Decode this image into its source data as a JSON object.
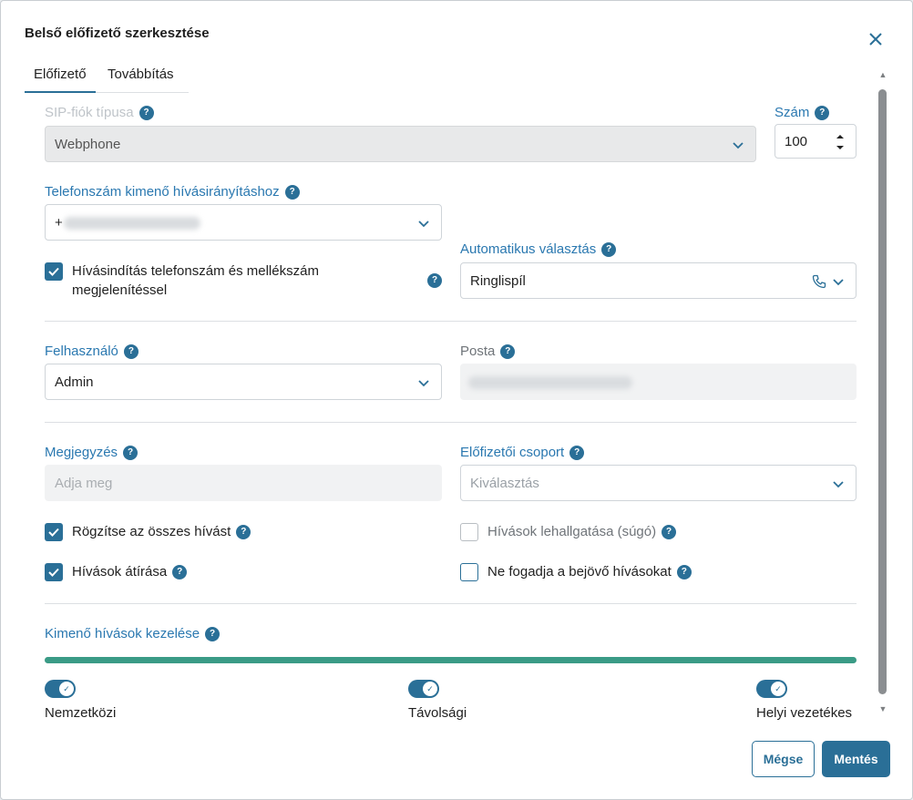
{
  "dialog": {
    "title": "Belső előfizető szerkesztése"
  },
  "tabs": [
    {
      "label": "Előfizető",
      "active": true
    },
    {
      "label": "Továbbítás",
      "active": false
    }
  ],
  "sip_type": {
    "label": "SIP-fiók típusa",
    "value": "Webphone"
  },
  "number": {
    "label": "Szám",
    "value": "100"
  },
  "outbound_phone": {
    "label": "Telefonszám kimenő hívásirányításhoz",
    "value_prefix": "+"
  },
  "call_display": {
    "label_line1": "Hívásindítás telefonszám és mellékszám",
    "label_line2": "megjelenítéssel",
    "checked": true
  },
  "auto_answer": {
    "label": "Automatikus választás",
    "value": "Ringlispíl"
  },
  "user": {
    "label": "Felhasználó",
    "value": "Admin"
  },
  "mail": {
    "label": "Posta"
  },
  "note": {
    "label": "Megjegyzés",
    "placeholder": "Adja meg"
  },
  "group": {
    "label": "Előfizetői csoport",
    "placeholder": "Kiválasztás"
  },
  "checks": {
    "record_all": {
      "label": "Rögzítse az összes hívást",
      "checked": true
    },
    "eavesdrop": {
      "label": "Hívások lehallgatása (súgó)",
      "checked": false
    },
    "transcribe": {
      "label": "Hívások átírása",
      "checked": true
    },
    "reject_incoming": {
      "label": "Ne fogadja a bejövő hívásokat",
      "checked": false
    }
  },
  "outbound_handling": {
    "label": "Kimenő hívások kezelése",
    "progress_percent": 100,
    "toggles": [
      {
        "label": "Nemzetközi",
        "on": true
      },
      {
        "label": "Távolsági",
        "on": true
      },
      {
        "label": "Helyi vezetékes",
        "on": true
      }
    ]
  },
  "buttons": {
    "cancel": "Mégse",
    "save": "Mentés"
  },
  "icons": {
    "help": "?",
    "check": "✓"
  },
  "colors": {
    "accent": "#2a6f97",
    "label": "#2a78b0",
    "progress": "#3a9b86"
  }
}
